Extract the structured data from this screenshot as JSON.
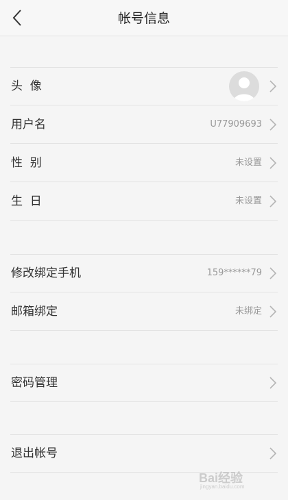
{
  "header": {
    "title": "帐号信息"
  },
  "sections": [
    [
      {
        "name": "avatar",
        "label": "头  像",
        "avatar": true
      },
      {
        "name": "username",
        "label": "用户名",
        "value": "U77909693"
      },
      {
        "name": "gender",
        "label": "性  别",
        "value": "未设置"
      },
      {
        "name": "birthday",
        "label": "生  日",
        "value": "未设置"
      }
    ],
    [
      {
        "name": "phone",
        "label": "修改绑定手机",
        "value": "159******79"
      },
      {
        "name": "email",
        "label": "邮箱绑定",
        "value": "未绑定"
      }
    ],
    [
      {
        "name": "password",
        "label": "密码管理"
      }
    ],
    [
      {
        "name": "logout",
        "label": "退出帐号"
      }
    ]
  ],
  "watermark": {
    "text": "Bai经验",
    "sub": "jingyan.baidu.com"
  },
  "colors": {
    "background": "#f5f5f5",
    "divider": "#e3e3e3",
    "value_text": "#999999",
    "chevron": "#b5b5b5"
  },
  "icons": {
    "back": "chevron-left-icon",
    "row_arrow": "chevron-right-icon",
    "avatar": "default-avatar-icon"
  }
}
